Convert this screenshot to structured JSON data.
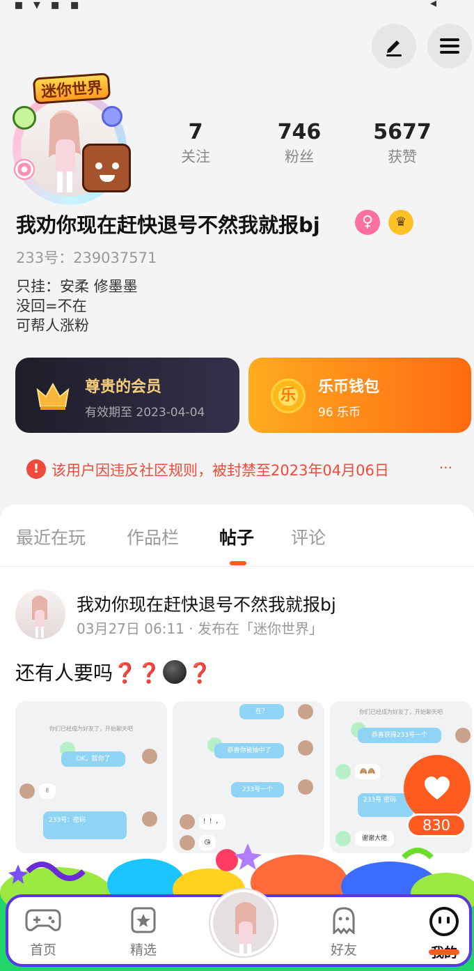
{
  "profile": {
    "nickname": "我劝你现在赶快退号不然我就报bj",
    "uid": "233号：239037571",
    "bio": [
      "只挂：安柔 修墨墨",
      "没回=不在",
      "可帮人涨粉"
    ],
    "brand_badge": "迷你世界",
    "gender_badge": "♀",
    "crown_badge": "♛"
  },
  "stats": [
    {
      "value": "7",
      "label": "关注"
    },
    {
      "value": "746",
      "label": "粉丝"
    },
    {
      "value": "5677",
      "label": "获赞"
    }
  ],
  "vip": {
    "title": "尊贵的会员",
    "subtitle": "有效期至 2023-04-04"
  },
  "wallet": {
    "coin_glyph": "乐",
    "title": "乐币钱包",
    "subtitle": "96 乐币"
  },
  "ban_notice": {
    "icon": "!",
    "text": "该用户因违反社区规则，被封禁至2023年04月06日",
    "more": "···"
  },
  "tabs": [
    {
      "label": "最近在玩"
    },
    {
      "label": "作品栏"
    },
    {
      "label": "帖子"
    },
    {
      "label": "评论"
    }
  ],
  "active_tab": "帖子",
  "post": {
    "author": "我劝你现在赶快退号不然我就报bj",
    "meta": "03月27日 06:11 · 发布在「迷你世界」",
    "text_main": "还有人要吗",
    "emoji_q": "❓",
    "like_count": "830",
    "screenshots": [
      {
        "system": "你们已经成为好友了，开始聊天吧",
        "bubble1": "OK，就你了",
        "reply": "✌",
        "bubble2": "233号：密码"
      },
      {
        "bubble1": "在？",
        "bubble2": "恭喜你被抽中了",
        "bubble3": "233号一个",
        "reply1": "！！，",
        "reply2": "😘"
      },
      {
        "system": "你们已经成为好友了，开始聊天吧",
        "bubble1": "恭喜获得233号一个",
        "reply1": "🙈🙈",
        "bubble2": "233号 密码",
        "reply2": "谢谢大佬"
      }
    ]
  },
  "nav": [
    {
      "label": "首页",
      "icon": "gamepad-icon"
    },
    {
      "label": "精选",
      "icon": "star-card-icon"
    },
    {
      "label": "",
      "icon": "avatar"
    },
    {
      "label": "好友",
      "icon": "ghost-icon"
    },
    {
      "label": "我的",
      "icon": "smile-face-icon"
    }
  ],
  "colors": {
    "accent": "#ff5a1f",
    "ban": "#f04a3a",
    "vip_gold": "#f6cf7c",
    "nav_border": "#5a36e8"
  }
}
